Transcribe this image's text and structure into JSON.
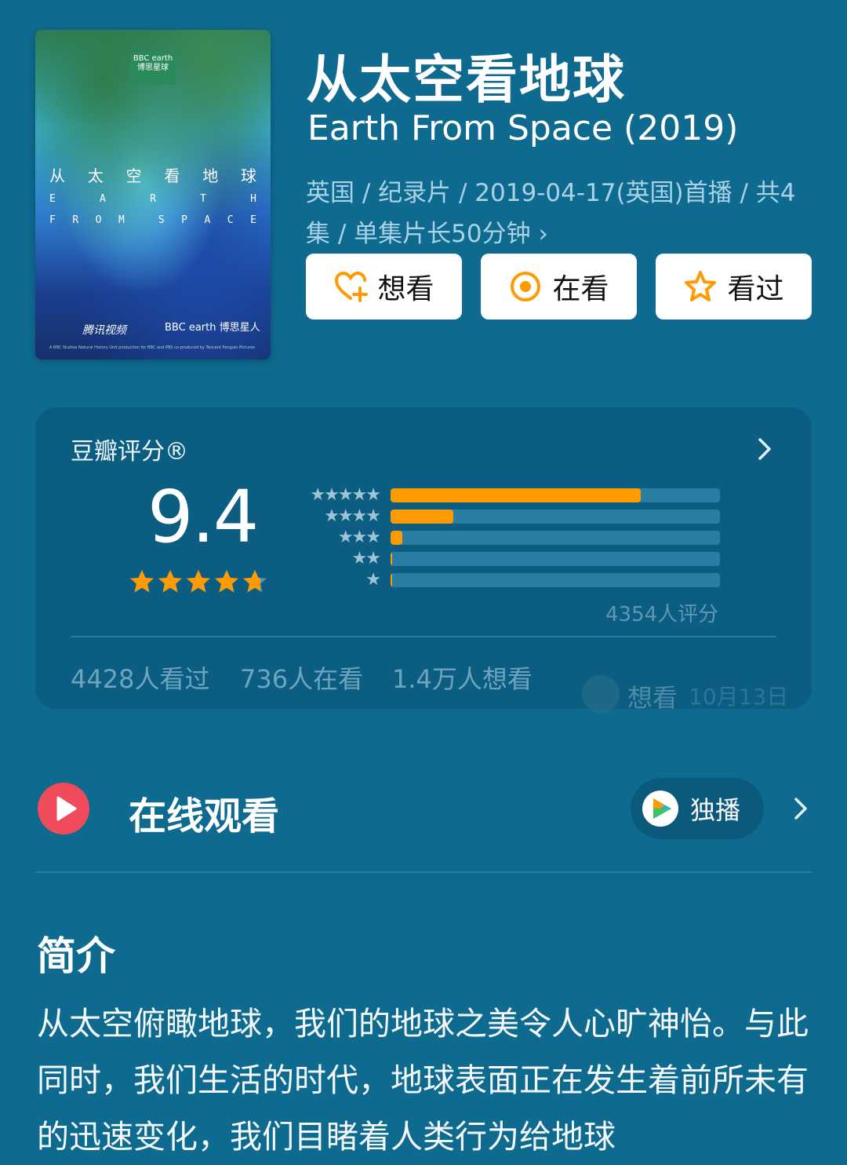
{
  "poster": {
    "logo_text": "BBC earth 博思星球",
    "cn_chars": [
      "从",
      "太",
      "空",
      "看",
      "地",
      "球"
    ],
    "row1": [
      "E",
      "A",
      "R",
      "T",
      "H"
    ],
    "row2": [
      "F",
      "R",
      "O",
      "M",
      "",
      "S",
      "P",
      "A",
      "C",
      "E"
    ],
    "brand1": "腾讯视频",
    "brand2": "BBC earth 博思星人",
    "credit": "A BBC Studios Natural History Unit production for BBC and PBS co-produced by Tencent Penguin Pictures"
  },
  "title_cn": "从太空看地球",
  "title_en": "Earth From Space (2019)",
  "meta_text": "英国 / 纪录片 / 2019-04-17(英国)首播 / 共4集 / 单集片长50分钟 ›",
  "buttons": {
    "want": "想看",
    "watching": "在看",
    "watched": "看过"
  },
  "rating": {
    "label": "豆瓣评分®",
    "score": "9.4",
    "stars_value": 4.7,
    "distribution": [
      {
        "stars": 5,
        "fraction": 0.76
      },
      {
        "stars": 4,
        "fraction": 0.19
      },
      {
        "stars": 3,
        "fraction": 0.035
      },
      {
        "stars": 2,
        "fraction": 0.005
      },
      {
        "stars": 1,
        "fraction": 0.005
      }
    ],
    "count_text": "4354人评分",
    "stats": {
      "watched": "4428人看过",
      "watching": "736人在看",
      "want": "1.4万人想看"
    },
    "user_mark": {
      "label": "想看",
      "date": "10月13日"
    }
  },
  "online": {
    "title": "在线观看",
    "source_label": "独播"
  },
  "intro": {
    "title": "简介",
    "body": "从太空俯瞰地球，我们的地球之美令人心旷神怡。与此同时，我们生活的时代，地球表面正在发生着前所未有的迅速变化，我们目睹着人类行为给地球"
  },
  "colors": {
    "background": "#0e6a8f",
    "card": "#0b5e82",
    "accent": "#ff9a00",
    "play": "#ef4b5a"
  }
}
